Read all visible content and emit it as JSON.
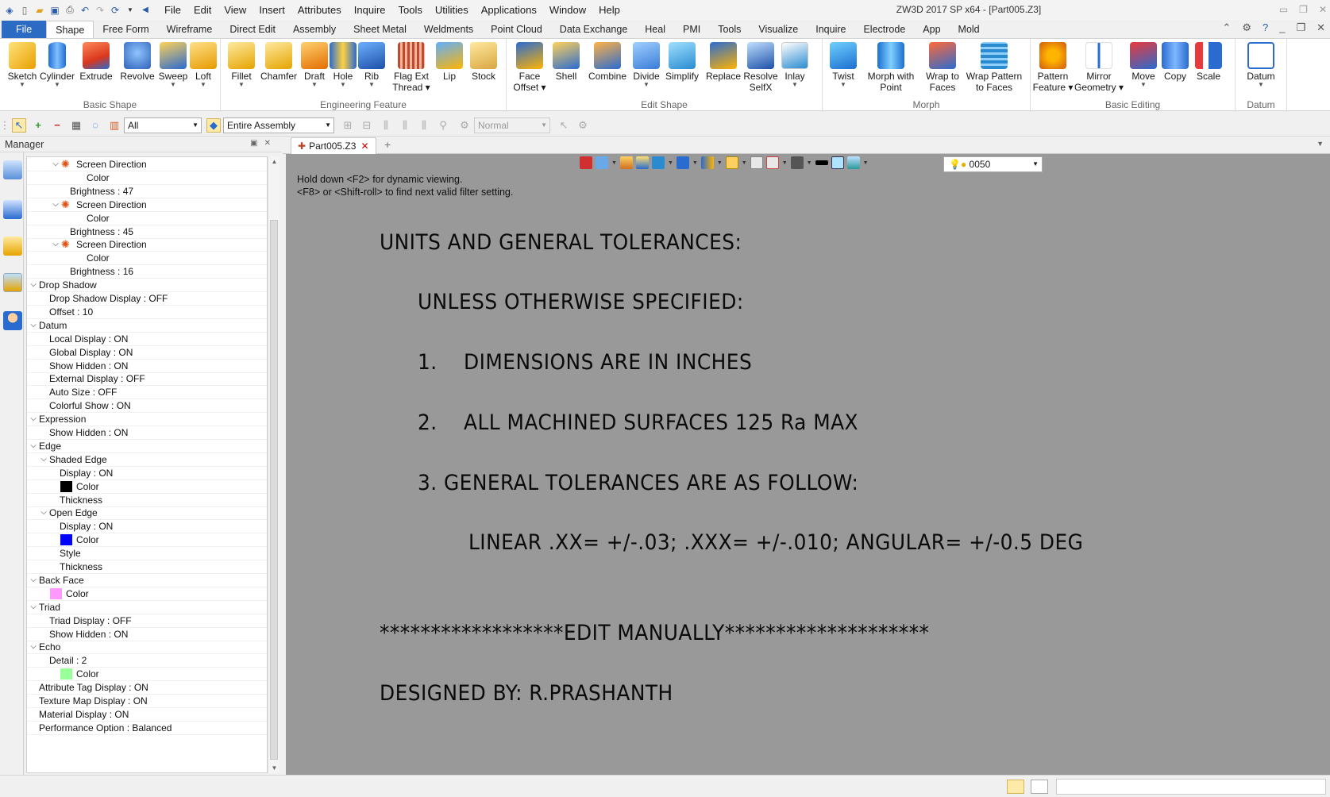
{
  "window": {
    "title": "ZW3D 2017 SP x64 - [Part005.Z3]"
  },
  "menubar": [
    "File",
    "Edit",
    "View",
    "Insert",
    "Attributes",
    "Inquire",
    "Tools",
    "Utilities",
    "Applications",
    "Window",
    "Help"
  ],
  "ribbon_tabs": [
    "File",
    "Shape",
    "Free Form",
    "Wireframe",
    "Direct Edit",
    "Assembly",
    "Sheet Metal",
    "Weldments",
    "Point Cloud",
    "Data Exchange",
    "Heal",
    "PMI",
    "Tools",
    "Visualize",
    "Inquire",
    "Electrode",
    "App",
    "Mold"
  ],
  "ribbon_active_tab": "Shape",
  "ribbon_groups": {
    "basic_shape": {
      "label": "Basic Shape",
      "buttons": [
        "Sketch",
        "Cylinder",
        "Extrude",
        "Revolve",
        "Sweep",
        "Loft"
      ]
    },
    "engineering_feature": {
      "label": "Engineering Feature",
      "buttons": [
        "Fillet",
        "Chamfer",
        "Draft",
        "Hole",
        "Rib",
        "Flag Ext",
        "Thread",
        "Lip",
        "Stock"
      ]
    },
    "edit_shape": {
      "label": "Edit Shape",
      "buttons": [
        "Face",
        "Offset",
        "Shell",
        "Combine",
        "Divide",
        "Simplify",
        "Replace",
        "Resolve",
        "SelfX",
        "Inlay"
      ]
    },
    "morph": {
      "label": "Morph",
      "buttons": [
        "Twist",
        "Morph with",
        "Point",
        "Wrap to",
        "Faces",
        "Wrap Pattern",
        "to Faces"
      ]
    },
    "basic_editing": {
      "label": "Basic Editing",
      "buttons": [
        "Pattern",
        "Feature",
        "Mirror",
        "Geometry",
        "Move",
        "Copy",
        "Scale"
      ]
    },
    "datum": {
      "label": "Datum",
      "buttons": [
        "Datum"
      ]
    }
  },
  "toolbar": {
    "filter_value": "All",
    "scope_value": "Entire Assembly",
    "mode_value": "Normal"
  },
  "manager": {
    "title": "Manager",
    "rows": [
      "Screen Direction",
      "Color",
      "Brightness : 47",
      "Screen Direction",
      "Color",
      "Brightness : 45",
      "Screen Direction",
      "Color",
      "Brightness : 16",
      "Drop Shadow",
      "Drop Shadow Display : OFF",
      "Offset : 10",
      "Datum",
      "Local Display : ON",
      "Global Display : ON",
      "Show Hidden : ON",
      "External Display : OFF",
      "Auto Size : OFF",
      "Colorful Show : ON",
      "Expression",
      "Show Hidden : ON",
      "Edge",
      "Shaded Edge",
      "Display : ON",
      "Color",
      "Thickness",
      "Open Edge",
      "Display : ON",
      "Color",
      "Style",
      "Thickness",
      "Back Face",
      "Color",
      "Triad",
      "Triad Display : OFF",
      "Show Hidden : ON",
      "Echo",
      "Detail : 2",
      "Color",
      "Attribute Tag Display : ON",
      "Texture Map Display : ON",
      "Material Display : ON",
      "Performance Option : Balanced"
    ],
    "swatch_colors": {
      "shaded_edge": "#000000",
      "open_edge": "#0000ff",
      "back_face": "#ff99ff",
      "echo": "#99ff99"
    }
  },
  "document_tab": "Part005.Z3",
  "viewport": {
    "layer_value": "0050",
    "hint_line1": "Hold down <F2> for dynamic viewing.",
    "hint_line2": "<F8> or <Shift-roll> to find next valid filter setting.",
    "lines": [
      "UNITS AND GENERAL TOLERANCES:",
      "UNLESS OTHERWISE SPECIFIED:",
      "1.    DIMENSIONS ARE IN INCHES",
      "2.    ALL MACHINED SURFACES 125 Ra MAX",
      "3. GENERAL TOLERANCES ARE AS FOLLOW:",
      "LINEAR .XX= +/-.03; .XXX= +/-.010; ANGULAR= +/-0.5 DEG",
      "******************EDIT MANUALLY********************",
      "DESIGNED BY: R.PRASHANTH"
    ],
    "background_color": "#999999"
  }
}
